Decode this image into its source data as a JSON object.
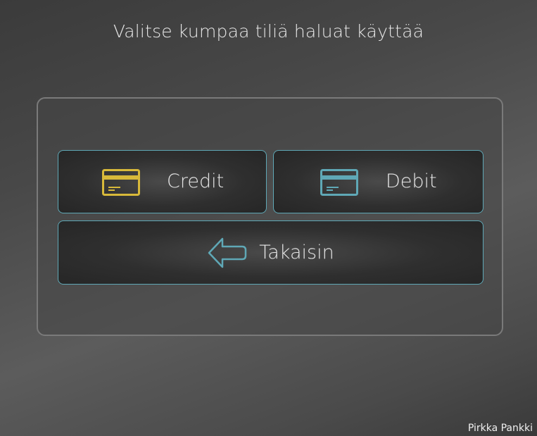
{
  "screen": {
    "title": "Valitse kumpaa tiliä haluat käyttää"
  },
  "buttons": {
    "credit": {
      "label": "Credit",
      "icon": "credit-card-icon",
      "icon_color": "#d8b93a"
    },
    "debit": {
      "label": "Debit",
      "icon": "debit-card-icon",
      "icon_color": "#5fa8b6"
    },
    "back": {
      "label": "Takaisin",
      "icon": "back-arrow-icon",
      "icon_color": "#5fa8b6"
    }
  },
  "footer": {
    "brand": "Pirkka Pankki"
  }
}
